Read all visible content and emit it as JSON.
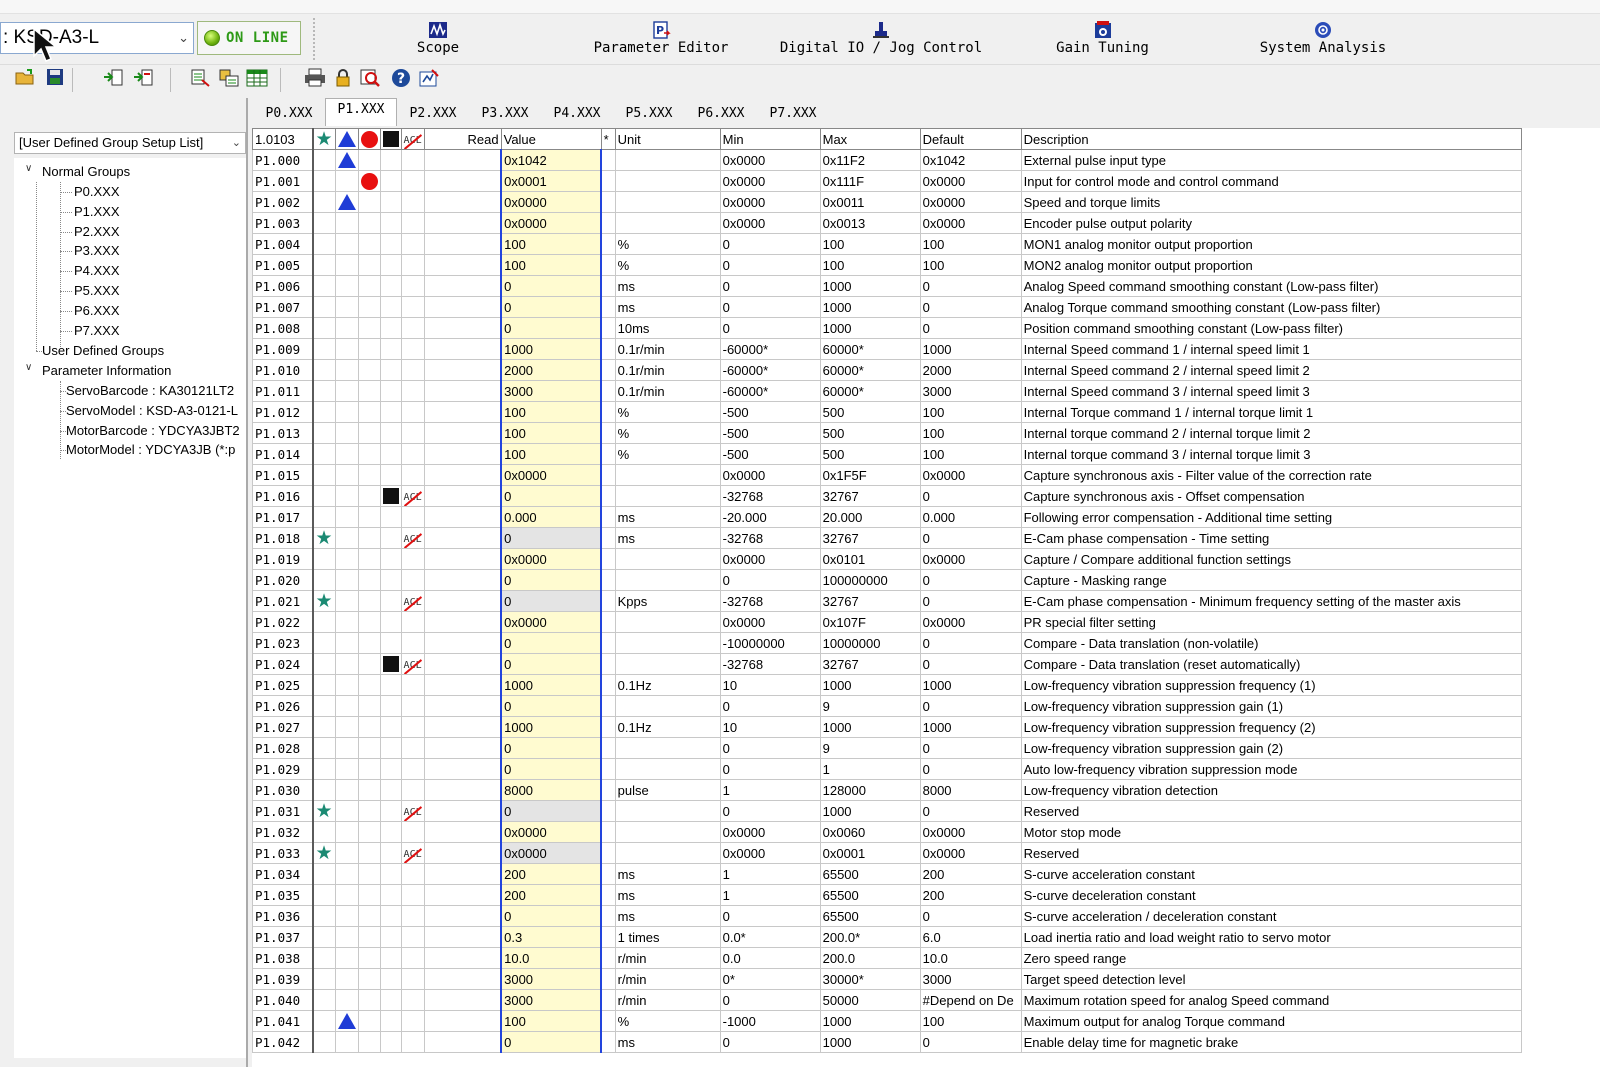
{
  "toolbar": {
    "drive_select": ": KSD-A3-L",
    "online_label": "ON LINE",
    "tools": [
      {
        "label": "Scope",
        "icon": "scope-icon"
      },
      {
        "label": "Parameter Editor",
        "icon": "parameter-editor-icon"
      },
      {
        "label": "Digital IO / Jog Control",
        "icon": "jog-control-icon"
      },
      {
        "label": "Gain Tuning",
        "icon": "gain-tuning-icon"
      },
      {
        "label": "System Analysis",
        "icon": "system-analysis-icon"
      }
    ],
    "secondary_icons": [
      "open-folder-icon",
      "save-icon",
      "upload-icon",
      "download-icon",
      "compare-icon",
      "copy-icon",
      "table-icon",
      "print-icon",
      "lock-icon",
      "search-icon",
      "help-icon",
      "wizard-icon"
    ]
  },
  "left_panel": {
    "group_select": "[User Defined Group Setup List]",
    "tree": {
      "normal_groups": "Normal Groups",
      "groups": [
        "P0.XXX",
        "P1.XXX",
        "P2.XXX",
        "P3.XXX",
        "P4.XXX",
        "P5.XXX",
        "P6.XXX",
        "P7.XXX"
      ],
      "user_defined": "User Defined Groups",
      "param_info": "Parameter Information",
      "info": [
        "ServoBarcode : KA30121LT2",
        "ServoModel : KSD-A3-0121-L",
        "MotorBarcode : YDCYA3JBT2",
        "MotorModel : YDCYA3JB (*:p"
      ]
    }
  },
  "tabs": [
    "P0.XXX",
    "P1.XXX",
    "P2.XXX",
    "P3.XXX",
    "P4.XXX",
    "P5.XXX",
    "P6.XXX",
    "P7.XXX"
  ],
  "active_tab": "P1.XXX",
  "grid": {
    "version": "1.0103",
    "headers": {
      "read": "Read",
      "value": "Value",
      "star": "*",
      "unit": "Unit",
      "min": "Min",
      "max": "Max",
      "default": "Default",
      "description": "Description"
    },
    "rows": [
      {
        "code": "P1.000",
        "flags": [
          "tri"
        ],
        "value": "0x1042",
        "unit": "",
        "min": "0x0000",
        "max": "0x11F2",
        "def": "0x1042",
        "desc": "External pulse input type"
      },
      {
        "code": "P1.001",
        "flags": [
          "circle"
        ],
        "value": "0x0001",
        "unit": "",
        "min": "0x0000",
        "max": "0x111F",
        "def": "0x0000",
        "desc": "Input for control mode and control command"
      },
      {
        "code": "P1.002",
        "flags": [
          "tri"
        ],
        "value": "0x0000",
        "unit": "",
        "min": "0x0000",
        "max": "0x0011",
        "def": "0x0000",
        "desc": "Speed and torque limits"
      },
      {
        "code": "P1.003",
        "flags": [],
        "value": "0x0000",
        "unit": "",
        "min": "0x0000",
        "max": "0x0013",
        "def": "0x0000",
        "desc": "Encoder pulse output polarity"
      },
      {
        "code": "P1.004",
        "flags": [],
        "value": "100",
        "unit": "%",
        "min": "0",
        "max": "100",
        "def": "100",
        "desc": "MON1 analog monitor output proportion"
      },
      {
        "code": "P1.005",
        "flags": [],
        "value": "100",
        "unit": "%",
        "min": "0",
        "max": "100",
        "def": "100",
        "desc": "MON2 analog monitor output proportion"
      },
      {
        "code": "P1.006",
        "flags": [],
        "value": "0",
        "unit": "ms",
        "min": "0",
        "max": "1000",
        "def": "0",
        "desc": "Analog Speed command smoothing constant (Low-pass filter)"
      },
      {
        "code": "P1.007",
        "flags": [],
        "value": "0",
        "unit": "ms",
        "min": "0",
        "max": "1000",
        "def": "0",
        "desc": "Analog Torque command smoothing constant (Low-pass filter)"
      },
      {
        "code": "P1.008",
        "flags": [],
        "value": "0",
        "unit": "10ms",
        "min": "0",
        "max": "1000",
        "def": "0",
        "desc": "Position command smoothing constant (Low-pass filter)"
      },
      {
        "code": "P1.009",
        "flags": [],
        "value": "1000",
        "unit": "0.1r/min",
        "min": "-60000*",
        "max": "60000*",
        "def": "1000",
        "desc": "Internal Speed command 1 / internal speed limit 1"
      },
      {
        "code": "P1.010",
        "flags": [],
        "value": "2000",
        "unit": "0.1r/min",
        "min": "-60000*",
        "max": "60000*",
        "def": "2000",
        "desc": "Internal Speed command 2 / internal speed limit 2"
      },
      {
        "code": "P1.011",
        "flags": [],
        "value": "3000",
        "unit": "0.1r/min",
        "min": "-60000*",
        "max": "60000*",
        "def": "3000",
        "desc": "Internal Speed command 3 / internal speed limit 3"
      },
      {
        "code": "P1.012",
        "flags": [],
        "value": "100",
        "unit": "%",
        "min": "-500",
        "max": "500",
        "def": "100",
        "desc": "Internal Torque command 1 / internal torque limit 1"
      },
      {
        "code": "P1.013",
        "flags": [],
        "value": "100",
        "unit": "%",
        "min": "-500",
        "max": "500",
        "def": "100",
        "desc": "Internal torque command 2 / internal torque limit 2"
      },
      {
        "code": "P1.014",
        "flags": [],
        "value": "100",
        "unit": "%",
        "min": "-500",
        "max": "500",
        "def": "100",
        "desc": "Internal torque command 3 / internal torque limit 3"
      },
      {
        "code": "P1.015",
        "flags": [],
        "value": "0x0000",
        "unit": "",
        "min": "0x0000",
        "max": "0x1F5F",
        "def": "0x0000",
        "desc": "Capture synchronous axis - Filter value of the correction rate"
      },
      {
        "code": "P1.016",
        "flags": [
          "square",
          "acl"
        ],
        "value": "0",
        "unit": "",
        "min": "-32768",
        "max": "32767",
        "def": "0",
        "desc": "Capture synchronous axis - Offset compensation"
      },
      {
        "code": "P1.017",
        "flags": [],
        "value": "0.000",
        "unit": "ms",
        "min": "-20.000",
        "max": "20.000",
        "def": "0.000",
        "desc": "Following error compensation - Additional time setting"
      },
      {
        "code": "P1.018",
        "flags": [
          "star",
          "acl"
        ],
        "value": "0",
        "ro": true,
        "unit": "ms",
        "min": "-32768",
        "max": "32767",
        "def": "0",
        "desc": "E-Cam phase compensation - Time setting"
      },
      {
        "code": "P1.019",
        "flags": [],
        "value": "0x0000",
        "unit": "",
        "min": "0x0000",
        "max": "0x0101",
        "def": "0x0000",
        "desc": "Capture / Compare additional function settings"
      },
      {
        "code": "P1.020",
        "flags": [],
        "value": "0",
        "unit": "",
        "min": "0",
        "max": "100000000",
        "def": "0",
        "desc": "Capture - Masking range"
      },
      {
        "code": "P1.021",
        "flags": [
          "star",
          "acl"
        ],
        "value": "0",
        "ro": true,
        "unit": "Kpps",
        "min": "-32768",
        "max": "32767",
        "def": "0",
        "desc": "E-Cam phase compensation - Minimum frequency setting of the master axis"
      },
      {
        "code": "P1.022",
        "flags": [],
        "value": "0x0000",
        "unit": "",
        "min": "0x0000",
        "max": "0x107F",
        "def": "0x0000",
        "desc": "PR special filter setting"
      },
      {
        "code": "P1.023",
        "flags": [],
        "value": "0",
        "unit": "",
        "min": "-10000000",
        "max": "10000000",
        "def": "0",
        "desc": "Compare - Data translation (non-volatile)"
      },
      {
        "code": "P1.024",
        "flags": [
          "square",
          "acl"
        ],
        "value": "0",
        "unit": "",
        "min": "-32768",
        "max": "32767",
        "def": "0",
        "desc": "Compare - Data translation (reset automatically)"
      },
      {
        "code": "P1.025",
        "flags": [],
        "value": "1000",
        "unit": "0.1Hz",
        "min": "10",
        "max": "1000",
        "def": "1000",
        "desc": "Low-frequency vibration suppression frequency (1)"
      },
      {
        "code": "P1.026",
        "flags": [],
        "value": "0",
        "unit": "",
        "min": "0",
        "max": "9",
        "def": "0",
        "desc": "Low-frequency vibration suppression gain (1)"
      },
      {
        "code": "P1.027",
        "flags": [],
        "value": "1000",
        "unit": "0.1Hz",
        "min": "10",
        "max": "1000",
        "def": "1000",
        "desc": "Low-frequency vibration suppression frequency (2)"
      },
      {
        "code": "P1.028",
        "flags": [],
        "value": "0",
        "unit": "",
        "min": "0",
        "max": "9",
        "def": "0",
        "desc": "Low-frequency vibration suppression gain (2)"
      },
      {
        "code": "P1.029",
        "flags": [],
        "value": "0",
        "unit": "",
        "min": "0",
        "max": "1",
        "def": "0",
        "desc": "Auto low-frequency vibration suppression mode"
      },
      {
        "code": "P1.030",
        "flags": [],
        "value": "8000",
        "unit": "pulse",
        "min": "1",
        "max": "128000",
        "def": "8000",
        "desc": "Low-frequency vibration detection"
      },
      {
        "code": "P1.031",
        "flags": [
          "star",
          "acl"
        ],
        "value": "0",
        "ro": true,
        "unit": "",
        "min": "0",
        "max": "1000",
        "def": "0",
        "desc": "Reserved"
      },
      {
        "code": "P1.032",
        "flags": [],
        "value": "0x0000",
        "unit": "",
        "min": "0x0000",
        "max": "0x0060",
        "def": "0x0000",
        "desc": "Motor stop mode"
      },
      {
        "code": "P1.033",
        "flags": [
          "star",
          "acl"
        ],
        "value": "0x0000",
        "ro": true,
        "unit": "",
        "min": "0x0000",
        "max": "0x0001",
        "def": "0x0000",
        "desc": "Reserved"
      },
      {
        "code": "P1.034",
        "flags": [],
        "value": "200",
        "unit": "ms",
        "min": "1",
        "max": "65500",
        "def": "200",
        "desc": "S-curve acceleration constant"
      },
      {
        "code": "P1.035",
        "flags": [],
        "value": "200",
        "unit": "ms",
        "min": "1",
        "max": "65500",
        "def": "200",
        "desc": "S-curve deceleration constant"
      },
      {
        "code": "P1.036",
        "flags": [],
        "value": "0",
        "unit": "ms",
        "min": "0",
        "max": "65500",
        "def": "0",
        "desc": "S-curve acceleration / deceleration constant"
      },
      {
        "code": "P1.037",
        "flags": [],
        "value": "0.3",
        "unit": "1 times",
        "min": "0.0*",
        "max": "200.0*",
        "def": "6.0",
        "desc": "Load inertia ratio and load weight ratio to servo motor"
      },
      {
        "code": "P1.038",
        "flags": [],
        "value": "10.0",
        "unit": "r/min",
        "min": "0.0",
        "max": "200.0",
        "def": "10.0",
        "desc": "Zero speed range"
      },
      {
        "code": "P1.039",
        "flags": [],
        "value": "3000",
        "unit": "r/min",
        "min": "0*",
        "max": "30000*",
        "def": "3000",
        "desc": "Target speed detection level"
      },
      {
        "code": "P1.040",
        "flags": [],
        "value": "3000",
        "unit": "r/min",
        "min": "0",
        "max": "50000",
        "def": "#Depend on De",
        "desc": "Maximum rotation speed for analog Speed command"
      },
      {
        "code": "P1.041",
        "flags": [
          "tri"
        ],
        "value": "100",
        "unit": "%",
        "min": "-1000",
        "max": "1000",
        "def": "100",
        "desc": "Maximum output for analog Torque command"
      },
      {
        "code": "P1.042",
        "flags": [],
        "value": "0",
        "unit": "ms",
        "min": "0",
        "max": "1000",
        "def": "0",
        "desc": "Enable delay time for magnetic brake"
      }
    ]
  }
}
